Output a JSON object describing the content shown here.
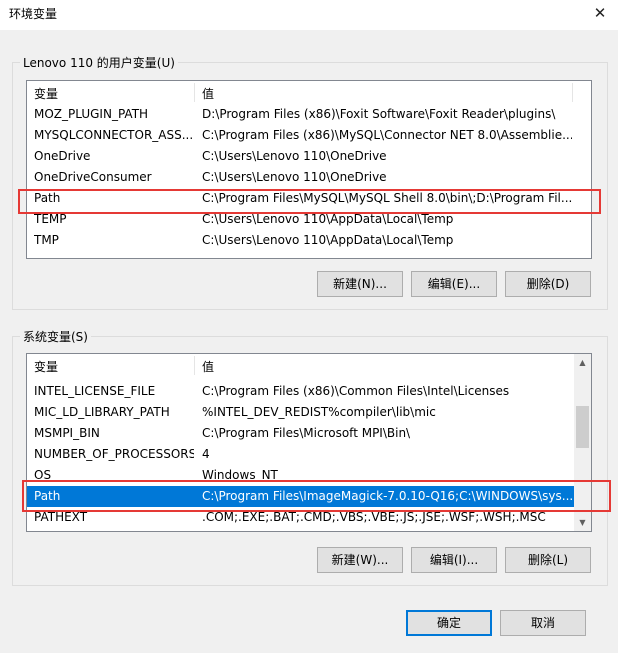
{
  "window": {
    "title": "环境变量",
    "close_symbol": "✕"
  },
  "user_vars": {
    "group_label": "Lenovo 110 的用户变量(U)",
    "col_name": "变量",
    "col_value": "值",
    "rows": [
      {
        "name": "MOZ_PLUGIN_PATH",
        "value": "D:\\Program Files (x86)\\Foxit Software\\Foxit Reader\\plugins\\"
      },
      {
        "name": "MYSQLCONNECTOR_ASS...",
        "value": "C:\\Program Files (x86)\\MySQL\\Connector NET 8.0\\Assemblie..."
      },
      {
        "name": "OneDrive",
        "value": "C:\\Users\\Lenovo 110\\OneDrive"
      },
      {
        "name": "OneDriveConsumer",
        "value": "C:\\Users\\Lenovo 110\\OneDrive"
      },
      {
        "name": "Path",
        "value": "C:\\Program Files\\MySQL\\MySQL Shell 8.0\\bin\\;D:\\Program Fil..."
      },
      {
        "name": "TEMP",
        "value": "C:\\Users\\Lenovo 110\\AppData\\Local\\Temp"
      },
      {
        "name": "TMP",
        "value": "C:\\Users\\Lenovo 110\\AppData\\Local\\Temp"
      }
    ],
    "btn_new": "新建(N)...",
    "btn_edit": "编辑(E)...",
    "btn_delete": "删除(D)"
  },
  "system_vars": {
    "group_label": "系统变量(S)",
    "col_name": "变量",
    "col_value": "值",
    "rows": [
      {
        "name": "INTEL_LICENSE_FILE",
        "value": "C:\\Program Files (x86)\\Common Files\\Intel\\Licenses"
      },
      {
        "name": "MIC_LD_LIBRARY_PATH",
        "value": "%INTEL_DEV_REDIST%compiler\\lib\\mic"
      },
      {
        "name": "MSMPI_BIN",
        "value": "C:\\Program Files\\Microsoft MPI\\Bin\\"
      },
      {
        "name": "NUMBER_OF_PROCESSORS",
        "value": "4"
      },
      {
        "name": "OS",
        "value": "Windows_NT"
      },
      {
        "name": "Path",
        "value": "C:\\Program Files\\ImageMagick-7.0.10-Q16;C:\\WINDOWS\\sys..."
      },
      {
        "name": "PATHEXT",
        "value": ".COM;.EXE;.BAT;.CMD;.VBS;.VBE;.JS;.JSE;.WSF;.WSH;.MSC"
      }
    ],
    "selected_index": 5,
    "btn_new": "新建(W)...",
    "btn_edit": "编辑(I)...",
    "btn_delete": "删除(L)"
  },
  "footer": {
    "ok": "确定",
    "cancel": "取消"
  }
}
